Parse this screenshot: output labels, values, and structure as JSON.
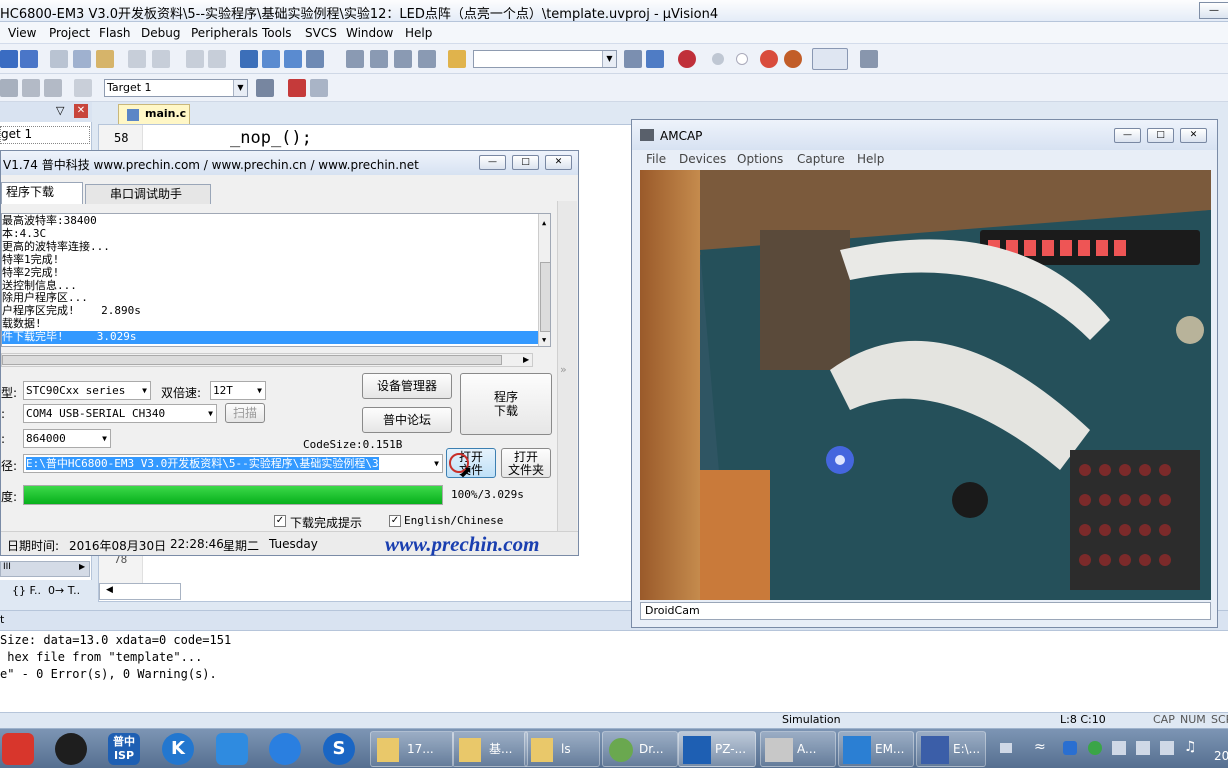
{
  "uvision": {
    "title": "HC6800-EM3 V3.0开发板资料\\5--实验程序\\基础实验例程\\实验12：LED点阵（点亮一个点）\\template.uvproj - µVision4",
    "menu": [
      "View",
      "Project",
      "Flash",
      "Debug",
      "Peripherals",
      "Tools",
      "SVCS",
      "Window",
      "Help"
    ],
    "target": "Target 1",
    "project_tree_item": "get 1",
    "tab": "main.c",
    "code_line_num": "58",
    "code_line": "_nop_();",
    "line_78": "78",
    "bottom_tabs": [
      "{} F..",
      "0→ T.."
    ],
    "output_lines": [
      "Size: data=13.0 xdata=0 code=151",
      " hex file from \"template\"...",
      "e\" - 0 Error(s), 0 Warning(s)."
    ],
    "status_simulation": "Simulation",
    "status_pos": "L:8 C:10",
    "status_keys": [
      "CAP",
      "NUM",
      "SCR"
    ]
  },
  "isp": {
    "title": "V1.74 普中科技 www.prechin.com / www.prechin.cn / www.prechin.net",
    "tabs": [
      "程序下载",
      "串口调试助手"
    ],
    "log": [
      "最高波特率:38400",
      "本:4.3C",
      "更高的波特率连接...",
      "特率1完成!",
      "特率2完成!",
      "送控制信息...",
      "除用户程序区...",
      "户程序区完成!    2.890s",
      "载数据!",
      "件下载完毕!     3.029s"
    ],
    "chip_label": "型:",
    "chip_value": "STC90Cxx series",
    "double_speed_label": "双倍速:",
    "double_speed_value": "12T",
    "port_label": ":",
    "port_value": "COM4  USB-SERIAL CH340",
    "scan_button": "扫描",
    "baud_label": ":",
    "baud_value": "864000",
    "device_manager_button": "设备管理器",
    "forum_button": "普中论坛",
    "download_button": "程序\n下载",
    "codesize": "CodeSize:0.151B",
    "path_label": "径:",
    "path_value": "E:\\普中HC6800-EM3 V3.0开发板资料\\5--实验程序\\基础实验例程\\3",
    "open_file_button": "打开\n文件",
    "open_folder_button": "打开\n文件夹",
    "progress_label": "度:",
    "progress_fraction": 1.0,
    "progress_text": "100%/3.029s",
    "checkbox_download_hint": "下载完成提示",
    "checkbox_language": "English/Chinese",
    "date_label": "日期时间:",
    "date_value": "2016年08月30日",
    "time_value": "22:28:46",
    "weekday_cn": "星期二",
    "weekday_en": "Tuesday",
    "website": "www.prechin.com"
  },
  "amcap": {
    "title": "AMCAP",
    "menu": [
      "File",
      "Devices",
      "Options",
      "Capture",
      "Help"
    ],
    "status": "DroidCam"
  },
  "taskbar": {
    "buttons": [
      "17...",
      "基...",
      "ls",
      "Dr...",
      "PZ-...",
      "A...",
      "EM...",
      "E:\\..."
    ],
    "isp_icon_text": "普中\nISP",
    "clock": "20"
  }
}
